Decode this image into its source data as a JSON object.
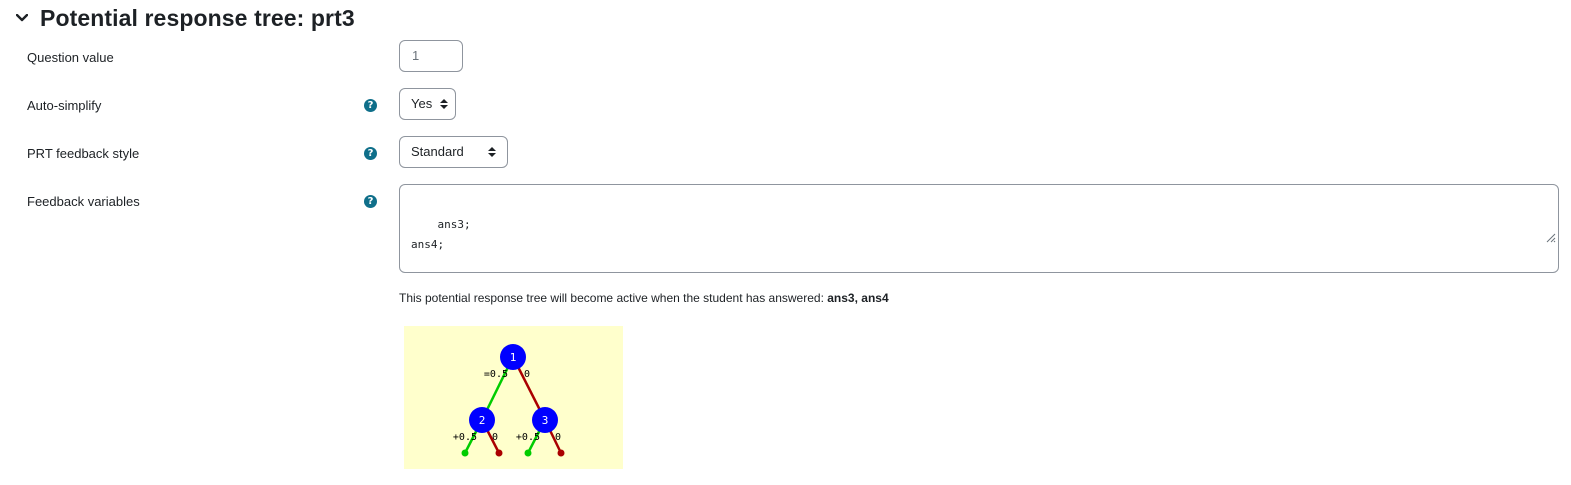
{
  "section": {
    "title": "Potential response tree: prt3"
  },
  "fields": {
    "question_value": {
      "label": "Question value",
      "value": "1"
    },
    "auto_simplify": {
      "label": "Auto-simplify",
      "selected": "Yes"
    },
    "feedback_style": {
      "label": "PRT feedback style",
      "selected": "Standard"
    },
    "feedback_variables": {
      "label": "Feedback variables",
      "value": "ans3;\nans4;"
    }
  },
  "active_note": {
    "prefix": "This potential response tree will become active when the student has answered: ",
    "inputs": "ans3, ans4"
  },
  "tree": {
    "nodes": [
      {
        "id": "1",
        "true_label": "=0.5",
        "false_label": "0"
      },
      {
        "id": "2",
        "true_label": "+0.5",
        "false_label": "0"
      },
      {
        "id": "3",
        "true_label": "+0.5",
        "false_label": "0"
      }
    ],
    "colors": {
      "node": "#0000ff",
      "true_branch": "#00cc00",
      "false_branch": "#aa0000",
      "background": "#ffffcc"
    }
  },
  "icons": {
    "collapse": "chevron-down-icon",
    "help": "question-circle-icon",
    "select_arrows": "sort-arrows-icon",
    "resize": "resize-grip-icon"
  }
}
